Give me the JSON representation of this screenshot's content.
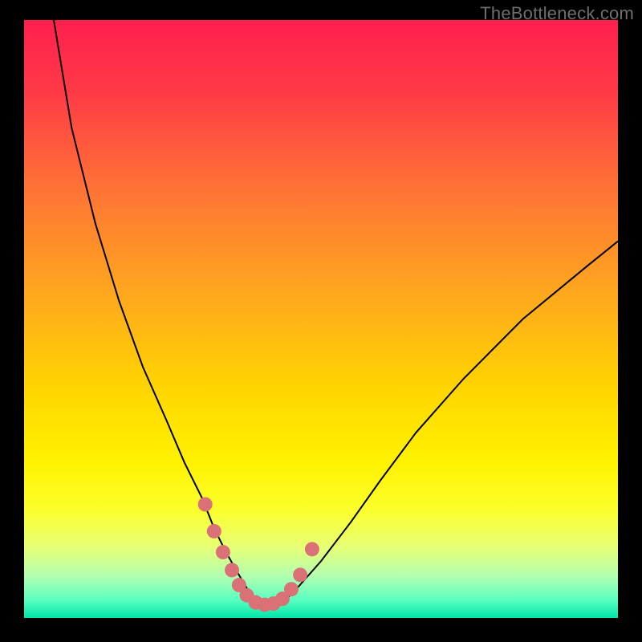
{
  "watermark": {
    "text": "TheBottleneck.com"
  },
  "colors": {
    "gradient_stops": [
      {
        "offset": 0.0,
        "color": "#ff1f4e"
      },
      {
        "offset": 0.12,
        "color": "#ff3a46"
      },
      {
        "offset": 0.28,
        "color": "#ff7236"
      },
      {
        "offset": 0.45,
        "color": "#ffa51f"
      },
      {
        "offset": 0.62,
        "color": "#ffd600"
      },
      {
        "offset": 0.74,
        "color": "#fff200"
      },
      {
        "offset": 0.82,
        "color": "#fbff2d"
      },
      {
        "offset": 0.88,
        "color": "#e8ff74"
      },
      {
        "offset": 0.93,
        "color": "#b3ffb0"
      },
      {
        "offset": 0.97,
        "color": "#5affc1"
      },
      {
        "offset": 1.0,
        "color": "#00e6a8"
      }
    ],
    "curve_stroke": "#000000",
    "marker_fill": "#d97176"
  },
  "chart_data": {
    "type": "line",
    "title": "",
    "xlabel": "",
    "ylabel": "",
    "xlim": [
      0,
      100
    ],
    "ylim": [
      0,
      100
    ],
    "series": [
      {
        "name": "bottleneck-curve",
        "x": [
          5,
          8,
          12,
          16,
          20,
          24,
          27,
          30,
          32,
          34,
          36,
          37.5,
          39,
          40.5,
          42,
          44,
          46,
          50,
          55,
          60,
          66,
          74,
          84,
          95,
          100
        ],
        "y": [
          100,
          82,
          66,
          53,
          42,
          33,
          26,
          20,
          15,
          11,
          7.5,
          5,
          3,
          2.2,
          2.2,
          3,
          5,
          9.5,
          16,
          23,
          31,
          40,
          50,
          59,
          63
        ]
      }
    ],
    "markers": {
      "name": "highlight-dots",
      "x": [
        30.5,
        32,
        33.5,
        35,
        36.2,
        37.5,
        39,
        40.5,
        42,
        43.5,
        45,
        46.5,
        48.5
      ],
      "y": [
        19,
        14.5,
        11,
        8,
        5.5,
        3.8,
        2.6,
        2.2,
        2.4,
        3.2,
        4.8,
        7.2,
        11.5
      ]
    }
  }
}
